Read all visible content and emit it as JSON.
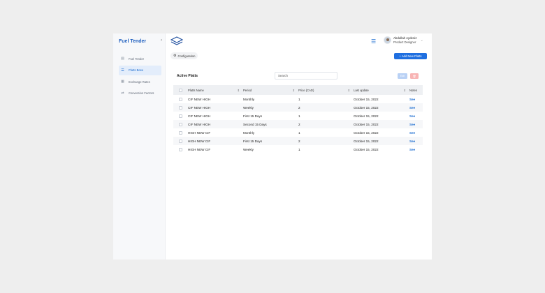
{
  "sidebar": {
    "brand": "Fuel Tender",
    "items": [
      {
        "label": "Fuel Tender",
        "icon": "document-icon",
        "glyph": "▤"
      },
      {
        "label": "Platts Base",
        "icon": "list-icon",
        "glyph": "☰"
      },
      {
        "label": "Exchange Rates",
        "icon": "calendar-icon",
        "glyph": "▦"
      },
      {
        "label": "Conversion Factors",
        "icon": "transfer-icon",
        "glyph": "⇄"
      }
    ]
  },
  "header": {
    "user_name": "Abdullah Aydeniz",
    "user_role": "Product Designer"
  },
  "toolbar": {
    "config_label": "Configuration",
    "add_label": "+ Add New Platts"
  },
  "card": {
    "title": "Active Platts",
    "search_placeholder": "Search",
    "edit_label": "Edit",
    "delete_label": "🗑"
  },
  "table": {
    "columns": [
      "Platts Name",
      "Period",
      "Price (CAD)",
      "Last update",
      "Notes"
    ],
    "rows": [
      {
        "name": "CIF NEW HIGH",
        "period": "Monthly",
        "price": "1",
        "updated": "October 15, 2022",
        "notes": "See"
      },
      {
        "name": "CIF NEW HIGH",
        "period": "Weekly",
        "price": "2",
        "updated": "October 15, 2022",
        "notes": "See"
      },
      {
        "name": "CIF NEW HIGH",
        "period": "First 15 Days",
        "price": "1",
        "updated": "October 15, 2022",
        "notes": "See"
      },
      {
        "name": "CIF NEW HIGH",
        "period": "Second 15 Days",
        "price": "2",
        "updated": "October 15, 2022",
        "notes": "See"
      },
      {
        "name": "HIGH NEW CIF",
        "period": "Monthly",
        "price": "1",
        "updated": "October 15, 2022",
        "notes": "See"
      },
      {
        "name": "HIGH NEW CIF",
        "period": "First 15 Days",
        "price": "2",
        "updated": "October 15, 2022",
        "notes": "See"
      },
      {
        "name": "HIGH NEW CIF",
        "period": "Weekly",
        "price": "1",
        "updated": "October 15, 2022",
        "notes": "See"
      }
    ]
  },
  "colors": {
    "accent": "#1f6fe0",
    "brand": "#1f5fbf",
    "delete": "#f8b4b4",
    "edit_disabled": "#b9d1f5"
  }
}
